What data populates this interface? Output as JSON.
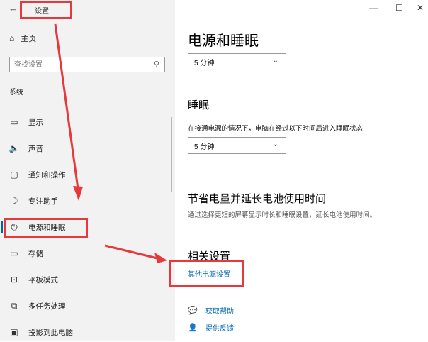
{
  "window": {
    "back_icon": "arrow-left-icon",
    "title": "设置",
    "minimize_glyph": "—",
    "maximize_glyph": "☐",
    "close_glyph": "✕"
  },
  "sidebar": {
    "home_label": "主页",
    "search_placeholder": "查找设置",
    "section_label": "系统",
    "items": [
      {
        "label": "显示",
        "icon": "monitor-icon",
        "glyph": "▭"
      },
      {
        "label": "声音",
        "icon": "speaker-icon",
        "glyph": "🔈"
      },
      {
        "label": "通知和操作",
        "icon": "notification-icon",
        "glyph": "▢"
      },
      {
        "label": "专注助手",
        "icon": "moon-icon",
        "glyph": "☽"
      },
      {
        "label": "电源和睡眠",
        "icon": "power-icon",
        "glyph": "⏻",
        "active": true
      },
      {
        "label": "存储",
        "icon": "storage-icon",
        "glyph": "▭"
      },
      {
        "label": "平板模式",
        "icon": "tablet-icon",
        "glyph": "⊡"
      },
      {
        "label": "多任务处理",
        "icon": "multitask-icon",
        "glyph": "⧉"
      },
      {
        "label": "投影到此电脑",
        "icon": "project-icon",
        "glyph": "▣"
      }
    ]
  },
  "main": {
    "title": "电源和睡眠",
    "screen_select_value": "5 分钟",
    "sleep_heading": "睡眠",
    "sleep_desc": "在接通电源的情况下，电脑在经过以下时间后进入睡眠状态",
    "sleep_select_value": "5 分钟",
    "save_heading": "节省电量并延长电池使用时间",
    "save_desc": "通过选择更短的屏幕显示时长和睡眠设置，延长电池使用时间。",
    "related_heading": "相关设置",
    "other_power_link": "其他电源设置",
    "get_help": "获取帮助",
    "feedback": "提供反馈"
  },
  "colors": {
    "accent": "#0067b8",
    "annotation_red": "#e5393b",
    "sidebar_bg": "#f2f2f2"
  }
}
